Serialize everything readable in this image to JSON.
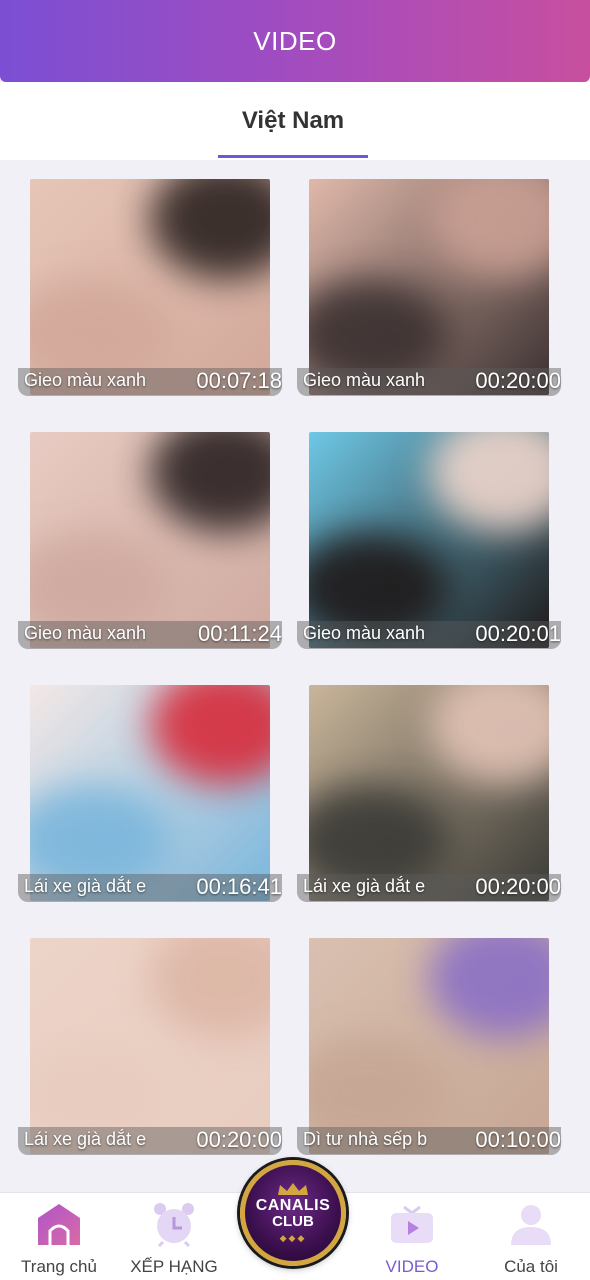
{
  "header": {
    "title": "VIDEO"
  },
  "tabs": [
    {
      "label": "Việt Nam",
      "active": true
    }
  ],
  "videos": [
    {
      "title": "Gieo màu xanh",
      "duration": "00:07:18",
      "colors": [
        "#e6c6b8",
        "#2b2220",
        "#d2a89a"
      ]
    },
    {
      "title": "Gieo màu xanh",
      "duration": "00:20:00",
      "colors": [
        "#e0b8aa",
        "#caa094",
        "#3a3030"
      ]
    },
    {
      "title": "Gieo màu xanh",
      "duration": "00:11:24",
      "colors": [
        "#e8cbc2",
        "#2a2222",
        "#cfaaa0"
      ]
    },
    {
      "title": "Gieo màu xanh",
      "duration": "00:20:01",
      "colors": [
        "#6ec8e6",
        "#f0d6cc",
        "#1e1818"
      ]
    },
    {
      "title": "Lái xe già dắt e",
      "duration": "00:16:41",
      "colors": [
        "#f3e8e6",
        "#d72b3a",
        "#7ab6dc"
      ]
    },
    {
      "title": "Lái xe già dắt e",
      "duration": "00:20:00",
      "colors": [
        "#c9b59a",
        "#e3c4b6",
        "#3a3a36"
      ]
    },
    {
      "title": "Lái xe già dắt e",
      "duration": "00:20:00",
      "colors": [
        "#edd4c8",
        "#dcb6a6",
        "#e8ccc0"
      ]
    },
    {
      "title": "Dì tư nhà sếp b",
      "duration": "00:10:00",
      "colors": [
        "#d9c0b0",
        "#8a6fc6",
        "#c6a694"
      ]
    }
  ],
  "bottom_nav": {
    "items": [
      {
        "label": "Trang chủ",
        "icon": "home-icon",
        "active": false
      },
      {
        "label": "XẾP HẠNG",
        "icon": "alarm-clock-icon",
        "active": false
      },
      {
        "label": "VIDEO",
        "icon": "video-play-icon",
        "active": true
      },
      {
        "label": "Của tôi",
        "icon": "user-icon",
        "active": false
      }
    ],
    "center_logo": {
      "name": "CANALIS",
      "sub": "CLUB"
    }
  },
  "colors": {
    "header_gradient": [
      "#7b4fd3",
      "#c84f9f"
    ],
    "accent": "#7a5bd0",
    "gold": "#d4a640"
  }
}
